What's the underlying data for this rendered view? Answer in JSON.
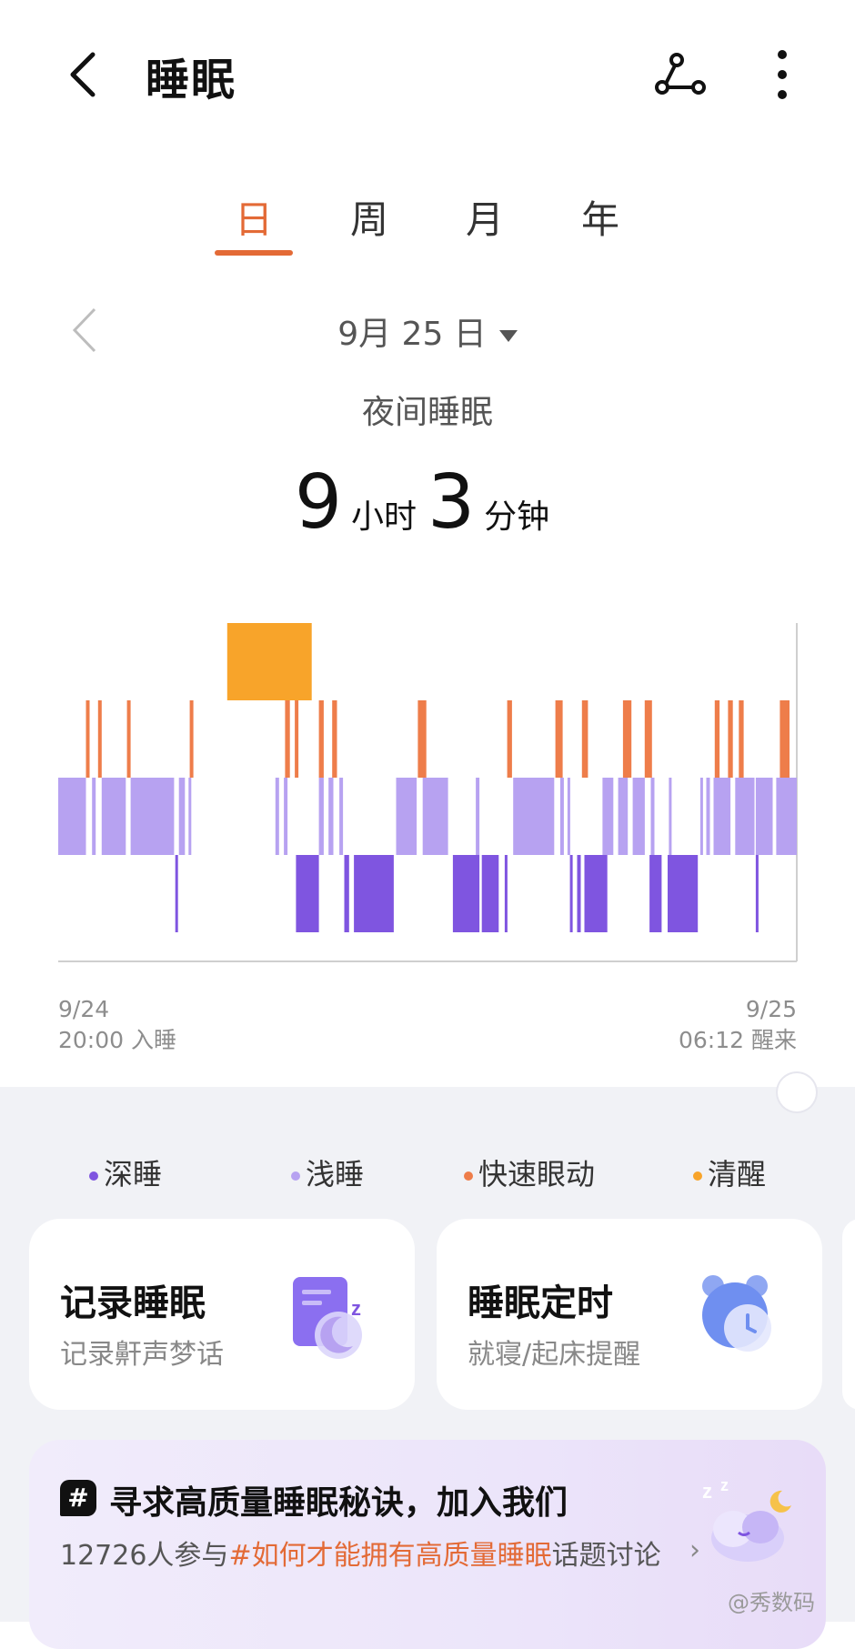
{
  "header": {
    "title": "睡眠",
    "share_icon": "share-icon",
    "more_icon": "more-vertical-icon"
  },
  "tabs": [
    {
      "label": "日",
      "active": true
    },
    {
      "label": "周",
      "active": false
    },
    {
      "label": "月",
      "active": false
    },
    {
      "label": "年",
      "active": false
    }
  ],
  "date_nav": {
    "date": "9月 25 日",
    "session": "夜间睡眠"
  },
  "summary": {
    "hours": "9",
    "hours_unit": "小时",
    "minutes": "3",
    "minutes_unit": "分钟"
  },
  "chart_data": {
    "type": "sleep-stage-timeline",
    "start": {
      "date": "9/24",
      "time_label": "20:00 入睡"
    },
    "end": {
      "date": "9/25",
      "time_label": "06:12 醒来"
    },
    "stages": [
      "清醒",
      "快速眼动",
      "浅睡",
      "深睡"
    ],
    "colors": {
      "清醒": "#f8a42a",
      "快速眼动": "#ee7d4a",
      "浅睡": "#b7a2f1",
      "深睡": "#7f55e0"
    },
    "segments_minutes": {
      "清醒": [
        [
          140,
          210
        ]
      ],
      "快速眼动": [
        [
          23,
          26
        ],
        [
          33,
          36
        ],
        [
          57,
          60
        ],
        [
          109,
          112
        ],
        [
          188,
          192
        ],
        [
          196,
          199
        ],
        [
          216,
          220
        ],
        [
          227,
          231
        ],
        [
          298,
          305
        ],
        [
          372,
          376
        ],
        [
          412,
          418
        ],
        [
          434,
          439
        ],
        [
          468,
          475
        ],
        [
          486,
          492
        ],
        [
          544,
          548
        ],
        [
          555,
          559
        ],
        [
          564,
          568
        ],
        [
          598,
          606
        ]
      ],
      "浅睡": [
        [
          0,
          23
        ],
        [
          28,
          31
        ],
        [
          36,
          56
        ],
        [
          60,
          96
        ],
        [
          100,
          105
        ],
        [
          108,
          110
        ],
        [
          180,
          183
        ],
        [
          187,
          190
        ],
        [
          216,
          220
        ],
        [
          224,
          228
        ],
        [
          233,
          236
        ],
        [
          280,
          297
        ],
        [
          302,
          323
        ],
        [
          346,
          349
        ],
        [
          377,
          411
        ],
        [
          416,
          419
        ],
        [
          422,
          424
        ],
        [
          451,
          460
        ],
        [
          464,
          472
        ],
        [
          476,
          486
        ],
        [
          491,
          494
        ],
        [
          506,
          508
        ],
        [
          532,
          534
        ],
        [
          537,
          540
        ],
        [
          543,
          557
        ],
        [
          561,
          577
        ],
        [
          578,
          592
        ],
        [
          595,
          612
        ]
      ],
      "深睡": [
        [
          97,
          99
        ],
        [
          197,
          216
        ],
        [
          237,
          241
        ],
        [
          245,
          278
        ],
        [
          327,
          349
        ],
        [
          351,
          365
        ],
        [
          370,
          372
        ],
        [
          424,
          426
        ],
        [
          430,
          433
        ],
        [
          436,
          455
        ],
        [
          490,
          500
        ],
        [
          505,
          530
        ],
        [
          578,
          580
        ]
      ]
    }
  },
  "legend": [
    {
      "label": "深睡",
      "color": "#7f55e0"
    },
    {
      "label": "浅睡",
      "color": "#b7a2f1"
    },
    {
      "label": "快速眼动",
      "color": "#ee7d4a"
    },
    {
      "label": "清醒",
      "color": "#f8a42a"
    }
  ],
  "cards": [
    {
      "title": "记录睡眠",
      "subtitle": "记录鼾声梦话",
      "icon": "sleep-record-icon"
    },
    {
      "title": "睡眠定时",
      "subtitle": "就寝/起床提醒",
      "icon": "alarm-clock-icon"
    }
  ],
  "banner": {
    "title": "寻求高质量睡眠秘诀，加入我们",
    "sub_prefix": "12726人参与",
    "sub_topic": "#如何才能拥有高质量睡眠",
    "sub_suffix": "话题讨论",
    "chevron": "›",
    "icon": "sleeping-cloud-icon"
  },
  "watermark": "@秀数码"
}
